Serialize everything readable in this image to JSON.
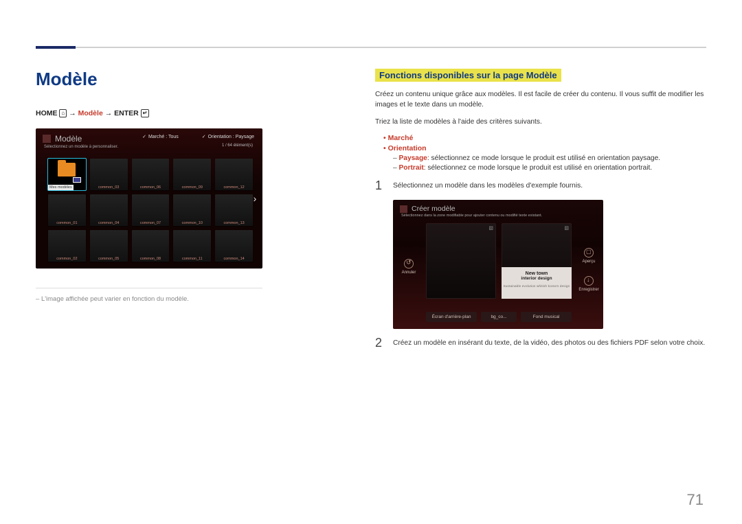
{
  "page_number": "71",
  "left": {
    "title": "Modèle",
    "breadcrumb": {
      "home": "HOME",
      "arrow": " → ",
      "middle": "Modèle",
      "last": "ENTER"
    },
    "note": "L'image affichée peut varier en fonction du modèle.",
    "screenshot1": {
      "title": "Modèle",
      "subtitle": "Sélectionnez un modèle à personnaliser.",
      "filter_market": "Marché : Tous",
      "filter_orientation": "Orientation : Paysage",
      "count": "1 / 64 élément(s)",
      "first_label": "Mes modèles",
      "labels": [
        "common_03",
        "common_06",
        "common_09",
        "common_12",
        "common_01",
        "common_04",
        "common_07",
        "common_10",
        "common_13",
        "common_02",
        "common_05",
        "common_08",
        "common_11",
        "common_14"
      ]
    }
  },
  "right": {
    "section_title": "Fonctions disponibles sur la page Modèle",
    "intro": "Créez un contenu unique grâce aux modèles. Il est facile de créer du contenu. Il vous suffit de modifier les images et le texte dans un modèle.",
    "sort_intro": "Triez la liste de modèles à l'aide des critères suivants.",
    "bullets": {
      "market": "Marché",
      "orientation": "Orientation"
    },
    "orientation_items": {
      "paysage_kw": "Paysage",
      "paysage_txt": ": sélectionnez ce mode lorsque le produit est utilisé en orientation paysage.",
      "portrait_kw": "Portrait",
      "portrait_txt": ": sélectionnez ce mode lorsque le produit est utilisé en orientation portrait."
    },
    "step1_num": "1",
    "step1": "Sélectionnez un modèle dans les modèles d'exemple fournis.",
    "step2_num": "2",
    "step2": "Créez un modèle en insérant du texte, de la vidéo, des photos ou des fichiers PDF selon votre choix.",
    "screenshot2": {
      "title": "Créer modèle",
      "subtitle": "Sélectionnez dans la zone modifiable pour ajouter contenu ou modifié texte existant.",
      "left_btn": "Annuler",
      "right_btn1": "Aperçu",
      "right_btn2": "Enregistrer",
      "panel_l1": "New town",
      "panel_l2": "interior design",
      "panel_l3": "Sustainable evolution whitish korea's design",
      "tab1": "Écran d'arrière-plan",
      "tab2": "bg_co...",
      "tab3": "Fond musical"
    }
  }
}
